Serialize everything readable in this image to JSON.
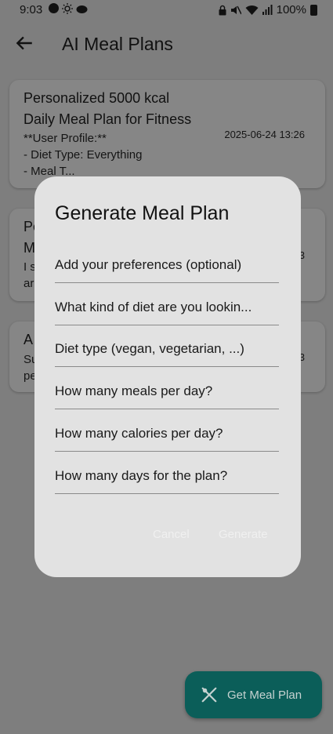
{
  "status_bar": {
    "time": "9:03",
    "battery": "100%"
  },
  "app_bar": {
    "title": "AI Meal Plans"
  },
  "cards": [
    {
      "title_line1": "Personalized 5000 kcal",
      "title_line2": "Daily Meal Plan for Fitness",
      "text": "**User Profile:**\n- Diet Type: Everything\n- Meal T...",
      "date": "2025-06-24 13:26"
    },
    {
      "title_line1": "Pe",
      "title_line2": "M",
      "text": "I s\nar",
      "date": "3"
    },
    {
      "title_line1": "A",
      "text": "Su\npe",
      "date": "3"
    }
  ],
  "dialog": {
    "title": "Generate Meal Plan",
    "fields": [
      {
        "placeholder": "Add your preferences (optional)"
      },
      {
        "placeholder": "What kind of diet are you lookin..."
      },
      {
        "placeholder": "Diet type (vegan, vegetarian, ...)"
      },
      {
        "placeholder": "How many meals per day?"
      },
      {
        "placeholder": "How many calories per day?"
      },
      {
        "placeholder": "How many days for the plan?"
      }
    ],
    "cancel_label": "Cancel",
    "generate_label": "Generate"
  },
  "fab": {
    "label": "Get Meal Plan",
    "icon": "utensils-icon"
  },
  "colors": {
    "scrim": "#7e7e7e",
    "dialog_bg": "#e2e2e2",
    "fab_bg": "#0b5e59"
  }
}
